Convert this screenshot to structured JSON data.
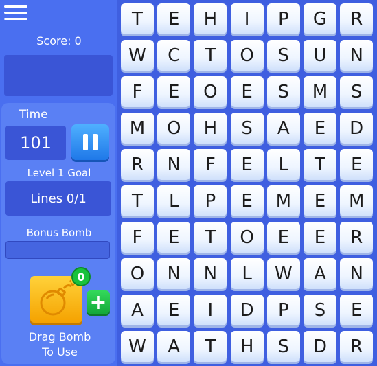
{
  "sidebar": {
    "score_label": "Score: 0",
    "time_label": "Time",
    "time_value": "101",
    "goal_label": "Level 1 Goal",
    "lines_label": "Lines 0/1",
    "bonus_label": "Bonus Bomb",
    "bonus_progress": 0,
    "bomb_count": "0",
    "plus_label": "+",
    "drag_line1": "Drag Bomb",
    "drag_line2": "To Use"
  },
  "colors": {
    "background": "#4a6ff0",
    "panel": "#3a55d6",
    "pause_button": "#1f78e8",
    "bomb_button": "#f5a200",
    "green": "#19c23c"
  },
  "board": {
    "rows": [
      [
        "T",
        "E",
        "H",
        "I",
        "P",
        "G",
        "R"
      ],
      [
        "W",
        "C",
        "T",
        "O",
        "S",
        "U",
        "N"
      ],
      [
        "F",
        "E",
        "O",
        "E",
        "S",
        "M",
        "S"
      ],
      [
        "M",
        "O",
        "H",
        "S",
        "A",
        "E",
        "D"
      ],
      [
        "R",
        "N",
        "F",
        "E",
        "L",
        "T",
        "E"
      ],
      [
        "T",
        "L",
        "P",
        "E",
        "M",
        "E",
        "M"
      ],
      [
        "F",
        "E",
        "T",
        "O",
        "E",
        "E",
        "R"
      ],
      [
        "O",
        "N",
        "N",
        "L",
        "W",
        "A",
        "N"
      ],
      [
        "A",
        "E",
        "I",
        "D",
        "P",
        "S",
        "E"
      ],
      [
        "W",
        "A",
        "T",
        "H",
        "S",
        "D",
        "R"
      ]
    ]
  }
}
